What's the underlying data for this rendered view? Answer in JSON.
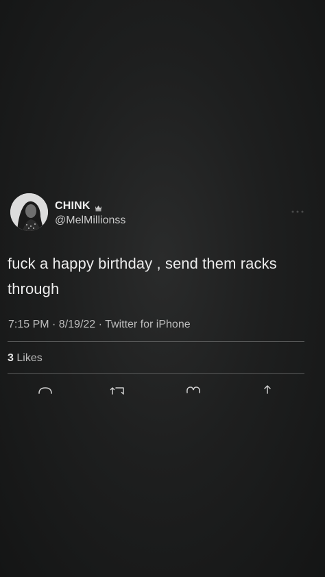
{
  "tweet": {
    "display_name": "CHINK",
    "badge_icon": "crown-icon",
    "handle": "@MelMillionss",
    "text": "fuck a happy birthday , send them racks through",
    "meta": "7:15 PM · 8/19/22 · Twitter for iPhone",
    "likes_count": "3",
    "likes_label": "Likes"
  },
  "actions": [
    "reply-icon",
    "retweet-icon",
    "like-icon",
    "share-icon"
  ],
  "colors": {
    "background": "#1e1f1f",
    "text": "#ececec",
    "secondary_text": "#bcbcbc",
    "divider": "#5a5b5b"
  }
}
